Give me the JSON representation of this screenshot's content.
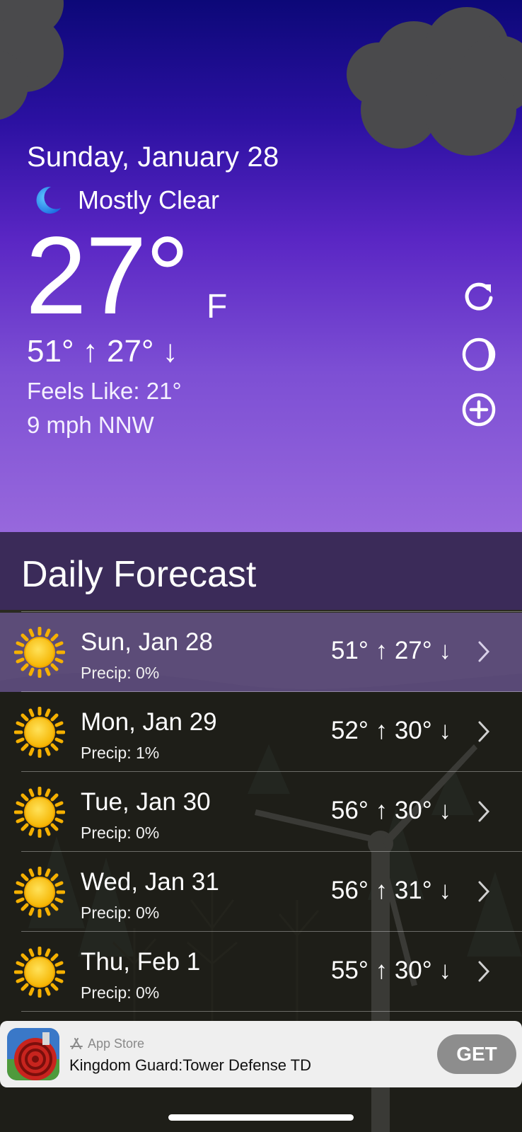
{
  "current": {
    "date": "Sunday, January 28",
    "condition": "Mostly Clear",
    "condition_icon": "moon-icon",
    "temperature": "27°",
    "unit": "F",
    "hi_lo": "51° ↑  27° ↓",
    "feels_like": "Feels Like: 21°",
    "wind": "9 mph NNW"
  },
  "controls": {
    "refresh_icon": "refresh-icon",
    "theme_icon": "moon-phase-icon",
    "add_icon": "add-circle-icon"
  },
  "forecast": {
    "title": "Daily Forecast",
    "days": [
      {
        "name": "Sun, Jan 28",
        "precip": "Precip: 0%",
        "hi_lo": "51° ↑  27° ↓",
        "icon": "sun-icon"
      },
      {
        "name": "Mon, Jan 29",
        "precip": "Precip: 1%",
        "hi_lo": "52° ↑  30° ↓",
        "icon": "sun-icon"
      },
      {
        "name": "Tue, Jan 30",
        "precip": "Precip: 0%",
        "hi_lo": "56° ↑  30° ↓",
        "icon": "sun-icon"
      },
      {
        "name": "Wed, Jan 31",
        "precip": "Precip: 0%",
        "hi_lo": "56° ↑  31° ↓",
        "icon": "sun-icon"
      },
      {
        "name": "Thu, Feb 1",
        "precip": "Precip: 0%",
        "hi_lo": "55° ↑  30° ↓",
        "icon": "sun-icon"
      }
    ]
  },
  "ad": {
    "source": "App Store",
    "title": "Kingdom Guard:Tower Defense TD",
    "button": "GET"
  },
  "colors": {
    "sky_top": "#0c0878",
    "sky_bottom": "#9768dc",
    "forecast_header": "#3c2c5c",
    "selected_row": "#6e5896",
    "sun": "#f5c518"
  }
}
